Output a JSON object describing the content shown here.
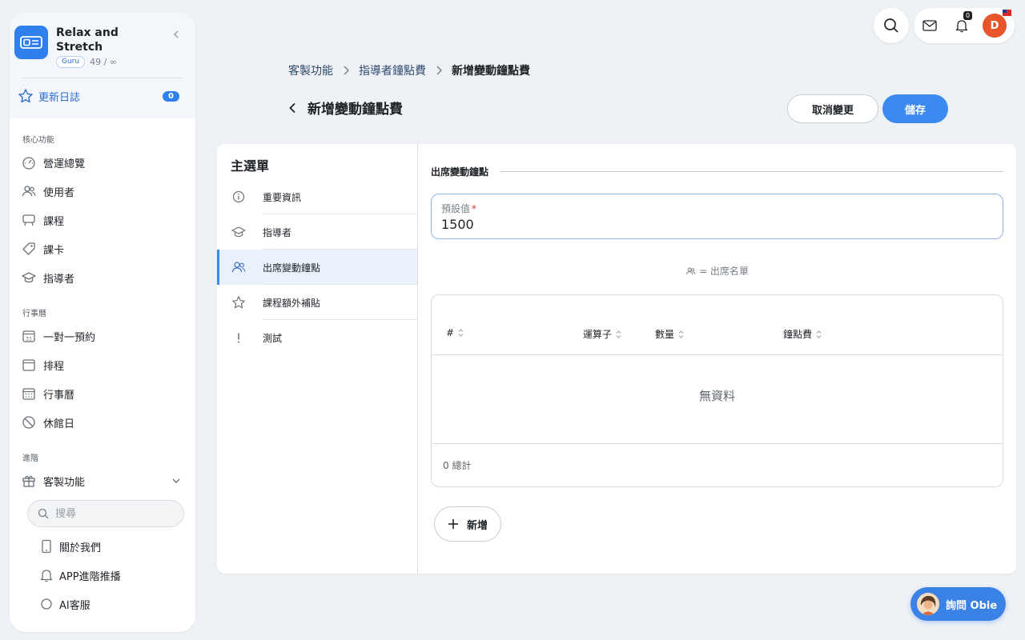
{
  "sidebar": {
    "brand_name": "Relax and Stretch",
    "plan_badge": "Guru",
    "usage": "49 / ∞",
    "changelog_label": "更新日誌",
    "changelog_count": "0",
    "sections": [
      {
        "title": "核心功能",
        "items": [
          {
            "label": "營運總覽",
            "icon": "dashboard-icon"
          },
          {
            "label": "使用者",
            "icon": "users-icon"
          },
          {
            "label": "課程",
            "icon": "course-icon"
          },
          {
            "label": "課卡",
            "icon": "tag-icon"
          },
          {
            "label": "指導者",
            "icon": "graduation-cap-icon"
          }
        ]
      },
      {
        "title": "行事曆",
        "items": [
          {
            "label": "一對一預約",
            "icon": "calendar-31-icon"
          },
          {
            "label": "排程",
            "icon": "calendar-icon"
          },
          {
            "label": "行事曆",
            "icon": "calendar-grid-icon"
          },
          {
            "label": "休館日",
            "icon": "ban-icon"
          }
        ]
      },
      {
        "title": "進階",
        "items": [
          {
            "label": "客製功能",
            "icon": "gift-icon"
          }
        ]
      }
    ],
    "search_placeholder": "搜尋",
    "sub_items": [
      {
        "label": "關於我們",
        "icon": "phone-icon"
      },
      {
        "label": "APP進階推播",
        "icon": "bell-icon"
      },
      {
        "label": "AI客服",
        "icon": "chat-icon"
      }
    ]
  },
  "topbar": {
    "notification_count": "0",
    "avatar_initial": "D"
  },
  "breadcrumb": [
    "客製功能",
    "指導者鐘點費",
    "新增變動鐘點費"
  ],
  "header": {
    "title": "新增變動鐘點費",
    "cancel_label": "取消變更",
    "save_label": "儲存"
  },
  "menu": {
    "title": "主選單",
    "items": [
      {
        "label": "重要資訊",
        "icon": "info-icon"
      },
      {
        "label": "指導者",
        "icon": "graduation-cap-icon"
      },
      {
        "label": "出席變動鐘點",
        "icon": "users-icon"
      },
      {
        "label": "課程額外補貼",
        "icon": "star-icon"
      },
      {
        "label": "測試",
        "icon": "exclamation-icon"
      }
    ],
    "active_index": 2
  },
  "content": {
    "section_title": "出席變動鐘點",
    "default_field_label": "預設值",
    "default_field_required": "*",
    "default_field_value": "1500",
    "legend_note": "= 出席名單",
    "table": {
      "columns": [
        "#",
        "運算子",
        "數量",
        "鐘點費"
      ],
      "empty_text": "無資料",
      "total_text": "0 總計"
    },
    "add_label": "新增"
  },
  "assistant": {
    "label": "詢問 Obie"
  },
  "colors": {
    "accent": "#3b8af0",
    "avatar": "#e8552b",
    "sidebar_top": "#f3f7fc"
  }
}
